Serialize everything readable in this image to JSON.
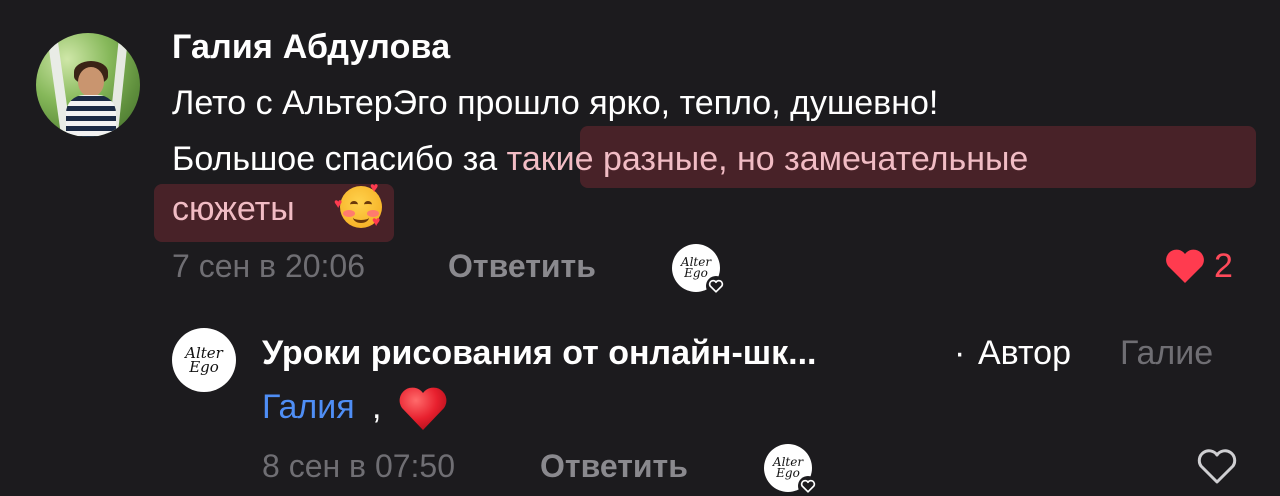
{
  "comment": {
    "author": "Галия Абдулова",
    "text_line1": "Лето с АльтерЭго прошло ярко, тепло, душевно!",
    "text_line2_plain": "Большое спасибо за ",
    "text_line2_highlight": "такие разные, но замечательные",
    "text_line3_highlight": "сюжеты",
    "emoji": "smiling-face-with-hearts",
    "timestamp": "7 сен в 20:06",
    "reply_label": "Ответить",
    "like_count": "2",
    "like_color": "#ff4a5a"
  },
  "reply": {
    "author": "Уроки рисования от онлайн-шк...",
    "separator": "·",
    "author_badge": "Автор",
    "reply_to": "Галие",
    "mention": "Галия",
    "comma": ",",
    "emoji": "red-heart",
    "timestamp": "8 сен в 07:50",
    "reply_label": "Ответить"
  },
  "logo_text": {
    "line1": "Alter",
    "line2": "Ego"
  },
  "colors": {
    "background": "#1c1b1e",
    "highlight_text": "#f1bcc4",
    "mention": "#4f8ef5",
    "muted": "#6f6e73"
  }
}
